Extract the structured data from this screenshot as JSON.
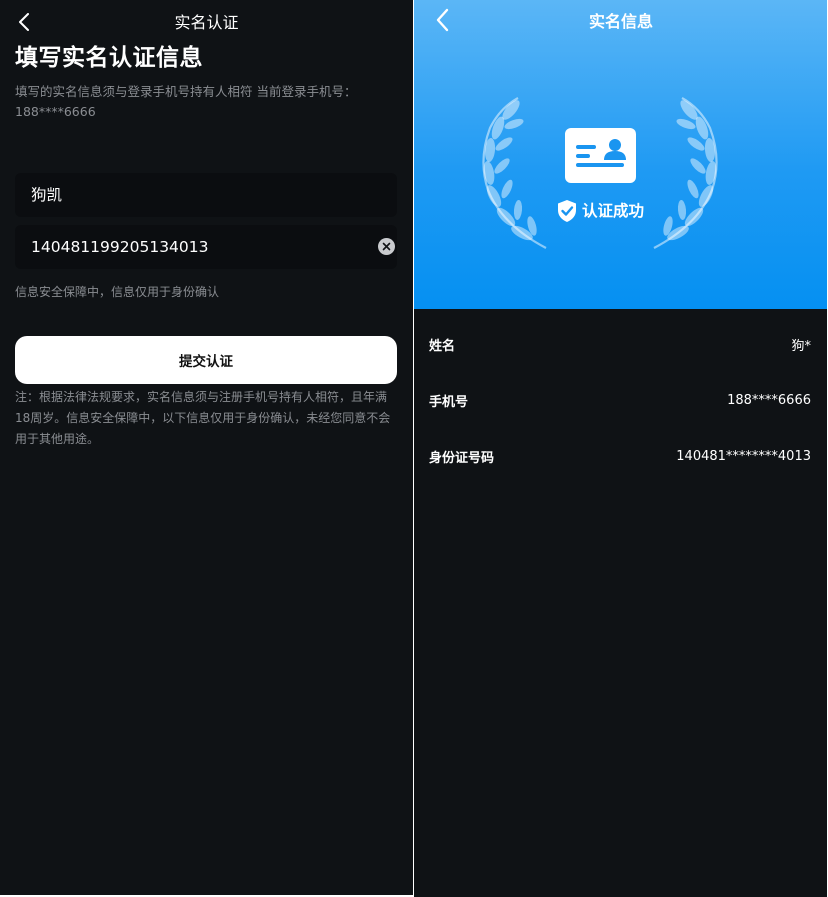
{
  "left": {
    "nav_title": "实名认证",
    "heading": "填写实名认证信息",
    "sub_line1": "填写的实名信息须与登录手机号持有人相符 当前登录手机号：",
    "sub_line2": "188****6666",
    "name_value": "狗凯",
    "id_value": "140481199205134013",
    "safe_text": "信息安全保障中，信息仅用于身份确认",
    "submit_label": "提交认证",
    "note": "注：根据法律法规要求，实名信息须与注册手机号持有人相符，且年满18周岁。信息安全保障中，以下信息仅用于身份确认，未经您同意不会用于其他用途。"
  },
  "right": {
    "nav_title": "实名信息",
    "success_text": "认证成功",
    "rows": [
      {
        "label": "姓名",
        "value": "狗*"
      },
      {
        "label": "手机号",
        "value": "188****6666"
      },
      {
        "label": "身份证号码",
        "value": "140481********4013"
      }
    ]
  },
  "colors": {
    "background": "#0f1215",
    "hero_top": "#5bb6f6",
    "hero_bottom": "#0590f2",
    "muted_text": "#8a8d92"
  },
  "icons": [
    "back-arrow-icon",
    "clear-icon",
    "id-card-icon",
    "shield-check-icon",
    "laurel-icon"
  ]
}
